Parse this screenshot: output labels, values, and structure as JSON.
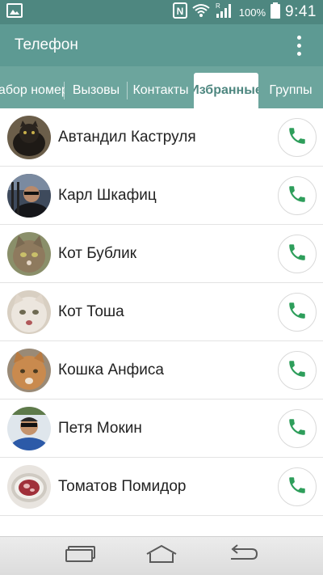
{
  "status_bar": {
    "battery_text": "100%",
    "time": "9:41",
    "icons": [
      "gallery-icon",
      "nfc-icon",
      "wifi-icon",
      "signal-icon",
      "battery-icon"
    ]
  },
  "app_bar": {
    "title": "Телефон",
    "menu_icon": "overflow-menu-icon"
  },
  "tabs": [
    {
      "label": "Набор номера",
      "active": false
    },
    {
      "label": "Вызовы",
      "active": false
    },
    {
      "label": "Контакты",
      "active": false
    },
    {
      "label": "Избранные",
      "active": true
    },
    {
      "label": "Группы",
      "active": false
    }
  ],
  "favorites": [
    {
      "name": "Автандил Каструля"
    },
    {
      "name": "Карл Шкафиц"
    },
    {
      "name": "Кот Бублик"
    },
    {
      "name": "Кот Тоша"
    },
    {
      "name": "Кошка Анфиса"
    },
    {
      "name": "Петя Мокин"
    },
    {
      "name": "Томатов Помидор"
    }
  ],
  "nav_bar": {
    "icons": [
      "recent-apps-icon",
      "home-icon",
      "back-icon"
    ]
  },
  "colors": {
    "status_bar": "#4e8780",
    "app_bar": "#5d9a93",
    "tab_bar": "#6ca59d",
    "call_icon": "#2e9e5b"
  }
}
